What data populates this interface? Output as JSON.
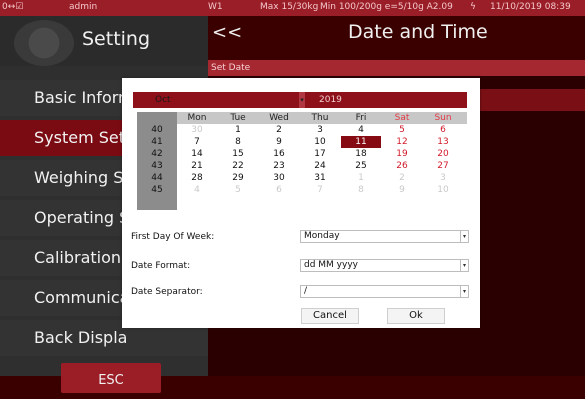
{
  "statusbar": {
    "left": "0↔☑",
    "user": "admin",
    "scale": "W1",
    "max": "Max 15/30kg",
    "min": "Min 100/200g e=5/10g A2.09",
    "datetime": "11/10/2019 08:39"
  },
  "sidebar": {
    "title": "Setting",
    "items": [
      {
        "label": "Basic Inform",
        "active": false
      },
      {
        "label": "System Set",
        "active": true
      },
      {
        "label": "Weighing S",
        "active": false
      },
      {
        "label": "Operating S",
        "active": false
      },
      {
        "label": "Calibration",
        "active": false
      },
      {
        "label": "Communica",
        "active": false
      },
      {
        "label": "Back Displa",
        "active": false
      }
    ],
    "esc_label": "ESC"
  },
  "header": {
    "back_label": "<<",
    "title": "Date and Time"
  },
  "crumb": "Set Date",
  "calendar": {
    "month": "Oct",
    "year": "2019",
    "weekdays": [
      "Mon",
      "Tue",
      "Wed",
      "Thu",
      "Fri",
      "Sat",
      "Sun"
    ],
    "weeks": [
      {
        "week": "40",
        "days": [
          "30",
          "1",
          "2",
          "3",
          "4",
          "5",
          "6"
        ]
      },
      {
        "week": "41",
        "days": [
          "7",
          "8",
          "9",
          "10",
          "11",
          "12",
          "13"
        ]
      },
      {
        "week": "42",
        "days": [
          "14",
          "15",
          "16",
          "17",
          "18",
          "19",
          "20"
        ]
      },
      {
        "week": "43",
        "days": [
          "21",
          "22",
          "23",
          "24",
          "25",
          "26",
          "27"
        ]
      },
      {
        "week": "44",
        "days": [
          "28",
          "29",
          "30",
          "31",
          "1",
          "2",
          "3"
        ]
      },
      {
        "week": "45",
        "days": [
          "4",
          "5",
          "6",
          "7",
          "8",
          "9",
          "10"
        ]
      }
    ],
    "selected_day": "11"
  },
  "form": {
    "first_day_label": "First Day Of Week:",
    "first_day_value": "Monday",
    "date_format_label": "Date Format:",
    "date_format_value": "dd MM yyyy",
    "separator_label": "Date Separator:",
    "separator_value": "/"
  },
  "buttons": {
    "cancel": "Cancel",
    "ok": "Ok"
  },
  "colors": {
    "accent": "#9b1d26",
    "selected": "#850a12",
    "weekend": "#d11a2a"
  }
}
